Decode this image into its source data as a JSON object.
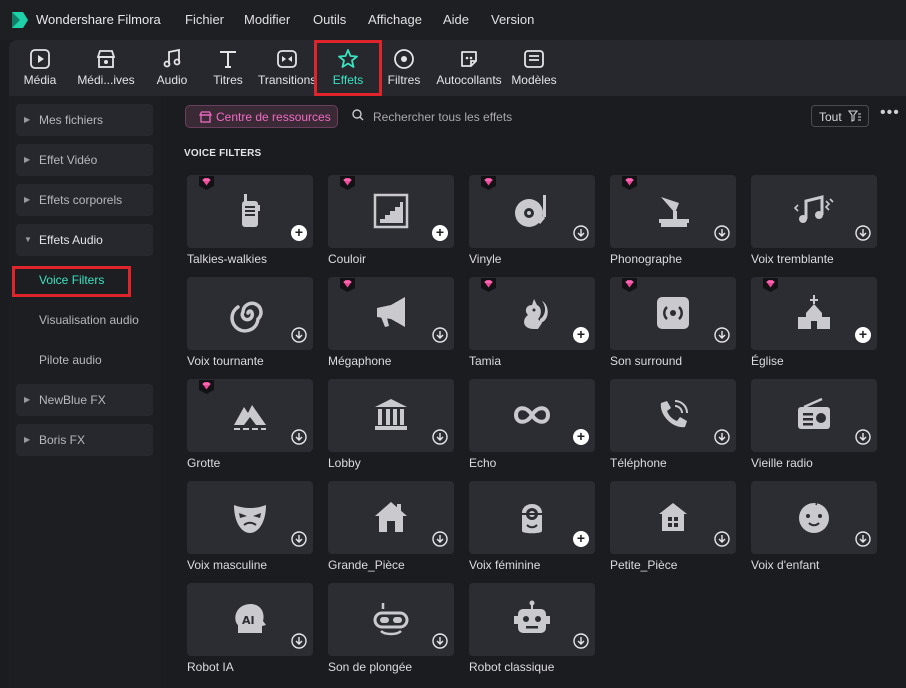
{
  "app": {
    "title": "Wondershare Filmora"
  },
  "menu": [
    "Fichier",
    "Modifier",
    "Outils",
    "Affichage",
    "Aide",
    "Version"
  ],
  "toolbar": {
    "items": [
      {
        "label": "Média",
        "icon": "media-icon"
      },
      {
        "label": "Médi...ives",
        "icon": "stock-media-icon"
      },
      {
        "label": "Audio",
        "icon": "music-note-icon"
      },
      {
        "label": "Titres",
        "icon": "text-icon"
      },
      {
        "label": "Transitions",
        "icon": "transition-icon"
      },
      {
        "label": "Effets",
        "icon": "effects-star-icon",
        "active": true
      },
      {
        "label": "Filtres",
        "icon": "filter-icon"
      },
      {
        "label": "Autocollants",
        "icon": "sticker-icon"
      },
      {
        "label": "Modèles",
        "icon": "template-icon"
      }
    ]
  },
  "sidebar": {
    "items": [
      {
        "label": "Mes fichiers",
        "type": "category"
      },
      {
        "label": "Effet Vidéo",
        "type": "category"
      },
      {
        "label": "Effets corporels",
        "type": "category"
      },
      {
        "label": "Effets Audio",
        "type": "category-open"
      },
      {
        "label": "Voice Filters",
        "type": "sub",
        "selected": true
      },
      {
        "label": "Visualisation audio",
        "type": "sub"
      },
      {
        "label": "Pilote audio",
        "type": "sub"
      },
      {
        "label": "NewBlue FX",
        "type": "category"
      },
      {
        "label": "Boris FX",
        "type": "category"
      }
    ]
  },
  "main": {
    "resource_button": "Centre de ressources",
    "search_placeholder": "Rechercher tous les effets",
    "filter_label": "Tout",
    "more_label": "•••",
    "section_title": "VOICE FILTERS",
    "accent_color": "#39e3c1",
    "premium_color": "#f0479b",
    "effects": [
      {
        "name": "Talkies-walkies",
        "icon": "walkie-talkie-icon",
        "premium": true,
        "action": "add"
      },
      {
        "name": "Couloir",
        "icon": "stairs-icon",
        "premium": true,
        "action": "add"
      },
      {
        "name": "Vinyle",
        "icon": "vinyl-turntable-icon",
        "premium": true,
        "action": "download"
      },
      {
        "name": "Phonographe",
        "icon": "phonograph-icon",
        "premium": true,
        "action": "download"
      },
      {
        "name": "Voix tremblante",
        "icon": "trembling-note-icon",
        "premium": false,
        "action": "download"
      },
      {
        "name": "Voix tournante",
        "icon": "spiral-icon",
        "premium": false,
        "action": "download"
      },
      {
        "name": "Mégaphone",
        "icon": "megaphone-icon",
        "premium": true,
        "action": "download"
      },
      {
        "name": "Tamia",
        "icon": "squirrel-icon",
        "premium": true,
        "action": "add"
      },
      {
        "name": "Son surround",
        "icon": "surround-speaker-icon",
        "premium": true,
        "action": "download"
      },
      {
        "name": "Église",
        "icon": "church-icon",
        "premium": true,
        "action": "add"
      },
      {
        "name": "Grotte",
        "icon": "cave-icon",
        "premium": true,
        "action": "download"
      },
      {
        "name": "Lobby",
        "icon": "building-icon",
        "premium": false,
        "action": "download"
      },
      {
        "name": "Echo",
        "icon": "infinity-icon",
        "premium": false,
        "action": "add"
      },
      {
        "name": "Téléphone",
        "icon": "phone-icon",
        "premium": false,
        "action": "download"
      },
      {
        "name": "Vieille radio",
        "icon": "radio-icon",
        "premium": false,
        "action": "download"
      },
      {
        "name": "Voix masculine",
        "icon": "mask-icon",
        "premium": false,
        "action": "download"
      },
      {
        "name": "Grande_Pièce",
        "icon": "house-icon",
        "premium": false,
        "action": "download"
      },
      {
        "name": "Voix féminine",
        "icon": "minion-icon",
        "premium": false,
        "action": "add"
      },
      {
        "name": "Petite_Pièce",
        "icon": "small-house-icon",
        "premium": false,
        "action": "download"
      },
      {
        "name": "Voix d'enfant",
        "icon": "baby-face-icon",
        "premium": false,
        "action": "download"
      },
      {
        "name": "Robot IA",
        "icon": "ai-head-icon",
        "premium": false,
        "action": "download"
      },
      {
        "name": "Son de plongée",
        "icon": "diving-mask-icon",
        "premium": false,
        "action": "download"
      },
      {
        "name": "Robot classique",
        "icon": "robot-icon",
        "premium": false,
        "action": "download"
      }
    ]
  }
}
